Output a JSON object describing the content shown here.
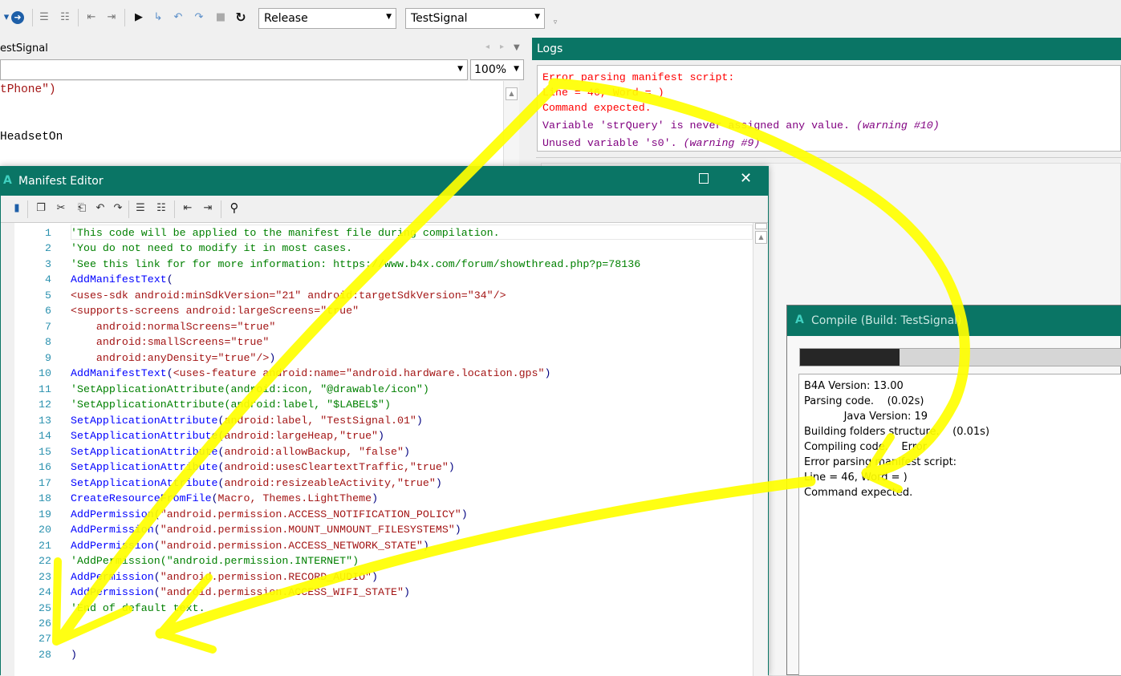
{
  "toolbar": {
    "build_config": "Release",
    "project": "TestSignal",
    "icons": [
      "navigate-forward-icon",
      "comment-icon",
      "uncomment-icon",
      "outdent-icon",
      "indent-icon",
      "run-icon",
      "step-in-icon",
      "step-over-icon",
      "step-out-icon",
      "stop-icon",
      "restart-icon"
    ]
  },
  "editor": {
    "tab_label": "estSignal",
    "zoom": "100%",
    "visible_code": [
      "tPhone\")",
      "HeadsetOn"
    ]
  },
  "logs": {
    "title": "Logs",
    "lines": [
      {
        "text": "Error parsing manifest script:",
        "type": "error"
      },
      {
        "text": "Line = 46, Word = )",
        "type": "error"
      },
      {
        "text": "Command expected.",
        "type": "error"
      },
      {
        "text": "Variable 'strQuery' is never assigned any value. ",
        "warn": "(warning #10)",
        "type": "warning"
      },
      {
        "text": "Unused variable 's0'. ",
        "warn": "(warning #9)",
        "type": "warning"
      }
    ],
    "colors": {
      "error": "#ff0000",
      "warning": "#800080"
    }
  },
  "manifest": {
    "title": "Manifest Editor",
    "tool_icons": [
      "save-icon",
      "copy-icon",
      "cut-icon",
      "paste-icon",
      "undo-icon",
      "redo-icon",
      "comment-icon",
      "uncomment-icon",
      "outdent-icon",
      "indent-icon",
      "find-icon"
    ],
    "lines": [
      {
        "n": "1",
        "segments": [
          {
            "t": "c",
            "text": "'This code will be applied to the manifest file during compilation."
          }
        ]
      },
      {
        "n": "2",
        "segments": [
          {
            "t": "c",
            "text": "'You do not need to modify it in most cases."
          }
        ]
      },
      {
        "n": "3",
        "segments": [
          {
            "t": "c",
            "text": "'See this link for for more information: https://www.b4x.com/forum/showthread.php?p=78136"
          }
        ]
      },
      {
        "n": "4",
        "segments": [
          {
            "t": "k",
            "text": "AddManifestText"
          },
          {
            "t": "p",
            "text": "("
          }
        ]
      },
      {
        "n": "5",
        "segments": [
          {
            "t": "s",
            "text": "<uses-sdk android:minSdkVersion=\"21\" android:targetSdkVersion=\"34\"/>"
          }
        ]
      },
      {
        "n": "6",
        "segments": [
          {
            "t": "s",
            "text": "<supports-screens android:largeScreens=\"true\""
          }
        ]
      },
      {
        "n": "7",
        "segments": [
          {
            "t": "s",
            "text": "    android:normalScreens=\"true\""
          }
        ]
      },
      {
        "n": "8",
        "segments": [
          {
            "t": "s",
            "text": "    android:smallScreens=\"true\""
          }
        ]
      },
      {
        "n": "9",
        "segments": [
          {
            "t": "s",
            "text": "    android:anyDensity=\"true\"/>"
          },
          {
            "t": "p",
            "text": ")"
          }
        ]
      },
      {
        "n": "10",
        "segments": [
          {
            "t": "k",
            "text": "AddManifestText"
          },
          {
            "t": "p",
            "text": "("
          },
          {
            "t": "s",
            "text": "<uses-feature android:name=\"android.hardware.location.gps\""
          },
          {
            "t": "p",
            "text": ")"
          }
        ]
      },
      {
        "n": "11",
        "segments": [
          {
            "t": "c",
            "text": "'SetApplicationAttribute(android:icon, \"@drawable/icon\")"
          }
        ]
      },
      {
        "n": "12",
        "segments": [
          {
            "t": "c",
            "text": "'SetApplicationAttribute(android:label, \"$LABEL$\")"
          }
        ]
      },
      {
        "n": "13",
        "segments": [
          {
            "t": "k",
            "text": "SetApplicationAttribute"
          },
          {
            "t": "p",
            "text": "("
          },
          {
            "t": "s",
            "text": "android:label, \"TestSignal.01\""
          },
          {
            "t": "p",
            "text": ")"
          }
        ]
      },
      {
        "n": "14",
        "segments": [
          {
            "t": "k",
            "text": "SetApplicationAttribute"
          },
          {
            "t": "p",
            "text": "("
          },
          {
            "t": "s",
            "text": "android:largeHeap,\"true\""
          },
          {
            "t": "p",
            "text": ")"
          }
        ]
      },
      {
        "n": "15",
        "segments": [
          {
            "t": "k",
            "text": "SetApplicationAttribute"
          },
          {
            "t": "p",
            "text": "("
          },
          {
            "t": "s",
            "text": "android:allowBackup, \"false\""
          },
          {
            "t": "p",
            "text": ")"
          }
        ]
      },
      {
        "n": "16",
        "segments": [
          {
            "t": "k",
            "text": "SetApplicationAttribute"
          },
          {
            "t": "p",
            "text": "("
          },
          {
            "t": "s",
            "text": "android:usesCleartextTraffic,\"true\""
          },
          {
            "t": "p",
            "text": ")"
          }
        ]
      },
      {
        "n": "17",
        "segments": [
          {
            "t": "k",
            "text": "SetApplicationAttribute"
          },
          {
            "t": "p",
            "text": "("
          },
          {
            "t": "s",
            "text": "android:resizeableActivity,\"true\""
          },
          {
            "t": "p",
            "text": ")"
          }
        ]
      },
      {
        "n": "18",
        "segments": [
          {
            "t": "k",
            "text": "CreateResourceFromFile"
          },
          {
            "t": "p",
            "text": "("
          },
          {
            "t": "s",
            "text": "Macro, Themes.LightTheme"
          },
          {
            "t": "p",
            "text": ")"
          }
        ]
      },
      {
        "n": "19",
        "segments": [
          {
            "t": "k",
            "text": "AddPermission"
          },
          {
            "t": "p",
            "text": "("
          },
          {
            "t": "s",
            "text": "\"android.permission.ACCESS_NOTIFICATION_POLICY\""
          },
          {
            "t": "p",
            "text": ")"
          }
        ]
      },
      {
        "n": "20",
        "segments": [
          {
            "t": "k",
            "text": "AddPermission"
          },
          {
            "t": "p",
            "text": "("
          },
          {
            "t": "s",
            "text": "\"android.permission.MOUNT_UNMOUNT_FILESYSTEMS\""
          },
          {
            "t": "p",
            "text": ")"
          }
        ]
      },
      {
        "n": "21",
        "segments": [
          {
            "t": "k",
            "text": "AddPermission"
          },
          {
            "t": "p",
            "text": "("
          },
          {
            "t": "s",
            "text": "\"android.permission.ACCESS_NETWORK_STATE\""
          },
          {
            "t": "p",
            "text": ")"
          }
        ]
      },
      {
        "n": "22",
        "segments": [
          {
            "t": "c",
            "text": "'AddPermission(\"android.permission.INTERNET\")"
          }
        ]
      },
      {
        "n": "23",
        "segments": [
          {
            "t": "k",
            "text": "AddPermission"
          },
          {
            "t": "p",
            "text": "("
          },
          {
            "t": "s",
            "text": "\"android.permission.RECORD_AUDIO\""
          },
          {
            "t": "p",
            "text": ")"
          }
        ]
      },
      {
        "n": "24",
        "segments": [
          {
            "t": "k",
            "text": "AddPermission"
          },
          {
            "t": "p",
            "text": "("
          },
          {
            "t": "s",
            "text": "\"android.permission.ACCESS_WIFI_STATE\""
          },
          {
            "t": "p",
            "text": ")"
          }
        ]
      },
      {
        "n": "25",
        "segments": [
          {
            "t": "c",
            "text": "'End of default text."
          }
        ]
      },
      {
        "n": "26",
        "segments": []
      },
      {
        "n": "27",
        "segments": []
      },
      {
        "n": "28",
        "segments": [
          {
            "t": "p",
            "text": ")"
          }
        ]
      }
    ]
  },
  "compile": {
    "title": "Compile (Build: TestSignal)",
    "progress_percent": 31,
    "lines": [
      "B4A Version: 13.00",
      "Parsing code.    (0.02s)",
      "            Java Version: 19",
      "Building folders structure.    (0.01s)",
      "Compiling code.    Error",
      "Error parsing manifest script:",
      "Line = 46, Word = )",
      "Command expected."
    ]
  },
  "annotation_color": "#ffff00"
}
